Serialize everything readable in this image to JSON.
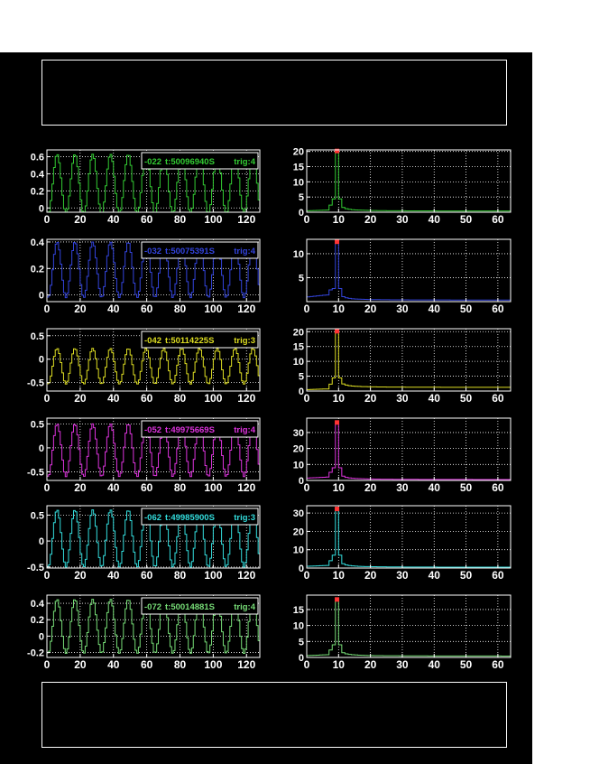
{
  "chart_data": [
    {
      "type": "line",
      "panel": "time",
      "xlim": [
        0,
        128
      ],
      "xticks": [
        0,
        20,
        40,
        60,
        80,
        100,
        120
      ],
      "ylim": [
        -0.05,
        0.68
      ],
      "yticks": [
        0,
        0.2,
        0.4,
        0.6
      ],
      "ytick_labels": [
        "0",
        "0.2",
        "0.4",
        "0.6"
      ],
      "color": "#33cc33",
      "baseline": 0.28,
      "amplitude": 0.35,
      "period": 10.7,
      "info_box": {
        "id": "-022",
        "time": "t:50096940S",
        "trig": "trig:4"
      }
    },
    {
      "type": "line",
      "panel": "spectrum",
      "xlim": [
        0,
        64
      ],
      "xticks": [
        0,
        10,
        20,
        30,
        40,
        50,
        60
      ],
      "ylim": [
        0,
        20.5
      ],
      "yticks": [
        0,
        5,
        10,
        15,
        20
      ],
      "ytick_labels": [
        "0",
        "5",
        "10",
        "15",
        "20"
      ],
      "color": "#33cc33",
      "peak_bin": 9,
      "peak_value": 20,
      "floor": 0.5,
      "tail": 0.35
    },
    {
      "type": "line",
      "panel": "time",
      "xlim": [
        0,
        128
      ],
      "xticks": [
        0,
        20,
        40,
        60,
        80,
        100,
        120
      ],
      "ylim": [
        -0.05,
        0.42
      ],
      "yticks": [
        0,
        0.2,
        0.4
      ],
      "ytick_labels": [
        "0",
        "0.2",
        "0.4"
      ],
      "color": "#3344dd",
      "baseline": 0.19,
      "amplitude": 0.21,
      "period": 10.7,
      "info_box": {
        "id": "-032",
        "time": "t:50075391S",
        "trig": "trig:4"
      }
    },
    {
      "type": "line",
      "panel": "spectrum",
      "xlim": [
        0,
        64
      ],
      "xticks": [
        0,
        10,
        20,
        30,
        40,
        50,
        60
      ],
      "ylim": [
        0,
        13
      ],
      "yticks": [
        5,
        10
      ],
      "ytick_labels": [
        "5",
        "10"
      ],
      "color": "#3344dd",
      "peak_bin": 9,
      "peak_value": 12.4,
      "floor": 1.0,
      "tail": 0.3
    },
    {
      "type": "line",
      "panel": "time",
      "xlim": [
        0,
        128
      ],
      "xticks": [
        0,
        20,
        40,
        60,
        80,
        100,
        120
      ],
      "ylim": [
        -0.68,
        0.65
      ],
      "yticks": [
        -0.5,
        0,
        0.5
      ],
      "ytick_labels": [
        "-0.5",
        "0",
        "0.5"
      ],
      "color": "#dddd22",
      "baseline": -0.15,
      "amplitude": 0.38,
      "period": 10.7,
      "info_box": {
        "id": "-042",
        "time": "t:50114225S",
        "trig": "trig:3"
      }
    },
    {
      "type": "line",
      "panel": "spectrum",
      "xlim": [
        0,
        64
      ],
      "xticks": [
        0,
        10,
        20,
        30,
        40,
        50,
        60
      ],
      "ylim": [
        0,
        21
      ],
      "yticks": [
        0,
        5,
        10,
        15,
        20
      ],
      "ytick_labels": [
        "0",
        "5",
        "10",
        "15",
        "20"
      ],
      "color": "#dddd22",
      "peak_bin": 9,
      "peak_value": 20,
      "floor": 0.5,
      "tail": 1.2
    },
    {
      "type": "line",
      "panel": "time",
      "xlim": [
        0,
        128
      ],
      "xticks": [
        0,
        20,
        40,
        60,
        80,
        100,
        120
      ],
      "ylim": [
        -0.68,
        0.62
      ],
      "yticks": [
        -0.5,
        0,
        0.5
      ],
      "ytick_labels": [
        "-0.5",
        "0",
        "0.5"
      ],
      "color": "#dd33dd",
      "baseline": -0.05,
      "amplitude": 0.55,
      "period": 10.7,
      "info_box": {
        "id": "-052",
        "time": "t:49975669S",
        "trig": "trig:4"
      }
    },
    {
      "type": "line",
      "panel": "spectrum",
      "xlim": [
        0,
        64
      ],
      "xticks": [
        0,
        10,
        20,
        30,
        40,
        50,
        60
      ],
      "ylim": [
        0,
        39
      ],
      "yticks": [
        0,
        10,
        20,
        30
      ],
      "ytick_labels": [
        "0",
        "10",
        "20",
        "30"
      ],
      "color": "#dd33dd",
      "peak_bin": 9,
      "peak_value": 36,
      "floor": 1.5,
      "tail": 0.5
    },
    {
      "type": "line",
      "panel": "time",
      "xlim": [
        0,
        128
      ],
      "xticks": [
        0,
        20,
        40,
        60,
        80,
        100,
        120
      ],
      "ylim": [
        -0.52,
        0.68
      ],
      "yticks": [
        -0.5,
        0,
        0.5
      ],
      "ytick_labels": [
        "-0.5",
        "0",
        "0.5"
      ],
      "color": "#33dddd",
      "baseline": 0.05,
      "amplitude": 0.55,
      "period": 10.7,
      "info_box": {
        "id": "-062",
        "time": "t:49985900S",
        "trig": "trig:3"
      }
    },
    {
      "type": "line",
      "panel": "spectrum",
      "xlim": [
        0,
        64
      ],
      "xticks": [
        0,
        10,
        20,
        30,
        40,
        50,
        60
      ],
      "ylim": [
        0,
        34
      ],
      "yticks": [
        0,
        10,
        20,
        30
      ],
      "ytick_labels": [
        "0",
        "10",
        "20",
        "30"
      ],
      "color": "#33dddd",
      "peak_bin": 9,
      "peak_value": 32,
      "floor": 1.0,
      "tail": 0.4
    },
    {
      "type": "line",
      "panel": "time",
      "xlim": [
        0,
        128
      ],
      "xticks": [
        0,
        20,
        40,
        60,
        80,
        100,
        120
      ],
      "ylim": [
        -0.26,
        0.5
      ],
      "yticks": [
        -0.2,
        0,
        0.2,
        0.4
      ],
      "ytick_labels": [
        "-0.2",
        "0",
        "0.2",
        "0.4"
      ],
      "color": "#77dd77",
      "baseline": 0.12,
      "amplitude": 0.33,
      "period": 10.7,
      "info_box": {
        "id": "-072",
        "time": "t:50014881S",
        "trig": "trig:4"
      }
    },
    {
      "type": "line",
      "panel": "spectrum",
      "xlim": [
        0,
        64
      ],
      "xticks": [
        0,
        10,
        20,
        30,
        40,
        50,
        60
      ],
      "ylim": [
        0,
        19.5
      ],
      "yticks": [
        0,
        5,
        10,
        15
      ],
      "ytick_labels": [
        "0",
        "5",
        "10",
        "15"
      ],
      "color": "#77dd77",
      "peak_bin": 9,
      "peak_value": 18,
      "floor": 0.6,
      "tail": 0.4
    }
  ]
}
